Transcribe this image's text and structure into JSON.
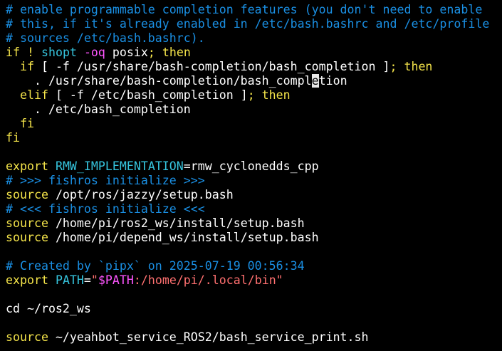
{
  "colors": {
    "background": "#000000",
    "comment": "#1a8fe3",
    "keyword": "#f4e44a",
    "builtin": "#36c5de",
    "text": "#ffffff",
    "string": "#ff7070",
    "variable": "#ff55ff"
  },
  "lines": [
    [
      {
        "t": "# enable programmable completion features (you don't need to enable",
        "c": "comment"
      }
    ],
    [
      {
        "t": "# this, if it's already enabled in /etc/bash.bashrc and /etc/profile",
        "c": "comment"
      }
    ],
    [
      {
        "t": "# sources /etc/bash.bashrc).",
        "c": "comment"
      }
    ],
    [
      {
        "t": "if",
        "c": "keyword"
      },
      {
        "t": " ",
        "c": "plain"
      },
      {
        "t": "!",
        "c": "keyword"
      },
      {
        "t": " ",
        "c": "plain"
      },
      {
        "t": "shopt",
        "c": "builtin"
      },
      {
        "t": " ",
        "c": "plain"
      },
      {
        "t": "-oq",
        "c": "variable"
      },
      {
        "t": " posix",
        "c": "plain"
      },
      {
        "t": "; then",
        "c": "keyword"
      }
    ],
    [
      {
        "t": "  ",
        "c": "plain"
      },
      {
        "t": "if",
        "c": "keyword"
      },
      {
        "t": " [ -f /usr/share/bash-completion/bash_completion ]",
        "c": "plain"
      },
      {
        "t": "; then",
        "c": "keyword"
      }
    ],
    [
      {
        "t": "    . /usr/share/bash-completion/bash_compl",
        "c": "plain"
      },
      {
        "t": "e",
        "c": "cursor"
      },
      {
        "t": "tion",
        "c": "plain"
      }
    ],
    [
      {
        "t": "  ",
        "c": "plain"
      },
      {
        "t": "elif",
        "c": "keyword"
      },
      {
        "t": " [ -f /etc/bash_completion ]",
        "c": "plain"
      },
      {
        "t": "; then",
        "c": "keyword"
      }
    ],
    [
      {
        "t": "    . /etc/bash_completion",
        "c": "plain"
      }
    ],
    [
      {
        "t": "  ",
        "c": "plain"
      },
      {
        "t": "fi",
        "c": "keyword"
      }
    ],
    [
      {
        "t": "fi",
        "c": "keyword"
      }
    ],
    [],
    [
      {
        "t": "export",
        "c": "keyword"
      },
      {
        "t": " ",
        "c": "plain"
      },
      {
        "t": "RMW_IMPLEMENTATION",
        "c": "builtin"
      },
      {
        "t": "=rmw_cyclonedds_cpp",
        "c": "plain"
      }
    ],
    [
      {
        "t": "# >>> fishros initialize >>>",
        "c": "comment"
      }
    ],
    [
      {
        "t": "source",
        "c": "keyword"
      },
      {
        "t": " /opt/ros/jazzy/setup.bash",
        "c": "plain"
      }
    ],
    [
      {
        "t": "# <<< fishros initialize <<<",
        "c": "comment"
      }
    ],
    [
      {
        "t": "source",
        "c": "keyword"
      },
      {
        "t": " /home/pi/ros2_ws/install/setup.bash",
        "c": "plain"
      }
    ],
    [
      {
        "t": "source",
        "c": "keyword"
      },
      {
        "t": " /home/pi/depend_ws/install/setup.bash",
        "c": "plain"
      }
    ],
    [],
    [
      {
        "t": "# Created by `pipx` on 2025-07-19 00:56:34",
        "c": "comment"
      }
    ],
    [
      {
        "t": "export",
        "c": "keyword"
      },
      {
        "t": " ",
        "c": "plain"
      },
      {
        "t": "PATH",
        "c": "builtin"
      },
      {
        "t": "=",
        "c": "plain"
      },
      {
        "t": "\"",
        "c": "string"
      },
      {
        "t": "$PATH",
        "c": "variable"
      },
      {
        "t": ":/home/pi/.local/bin\"",
        "c": "string"
      }
    ],
    [],
    [
      {
        "t": "cd ~/ros2_ws",
        "c": "plain"
      }
    ],
    [],
    [
      {
        "t": "source",
        "c": "keyword"
      },
      {
        "t": " ~/yeahbot_service_ROS2/bash_service_print.sh",
        "c": "plain"
      }
    ]
  ]
}
